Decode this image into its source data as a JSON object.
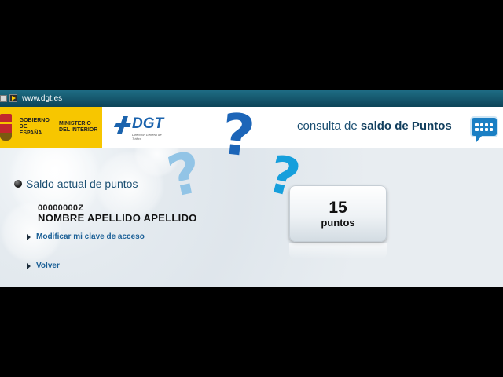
{
  "browser": {
    "url": "www.dgt.es"
  },
  "header": {
    "gobierno_label": "GOBIERNO DE ESPAÑA",
    "ministerio_label": "MINISTERIO DEL INTERIOR",
    "dgt_name": "DGT",
    "dgt_subtitle": "Dirección General de Tráfico",
    "title_prefix": "consulta de ",
    "title_bold": "saldo de Puntos"
  },
  "decor": {
    "question_mark": "?"
  },
  "section": {
    "title": "Saldo actual de puntos"
  },
  "user": {
    "id": "00000000Z",
    "name": "NOMBRE APELLIDO APELLIDO"
  },
  "links": {
    "change_password": "Modificar mi clave de acceso",
    "back": "Volver"
  },
  "points": {
    "value": "15",
    "unit": "puntos"
  },
  "colors": {
    "accent": "#1b63ad",
    "gov_yellow": "#f7c600",
    "link": "#1a5f96",
    "bar": "#0d4458"
  },
  "icons": {
    "brand": "chat-bubble-icon",
    "section_bullet": "bullet-icon",
    "link_arrow": "triangle-right-icon"
  }
}
